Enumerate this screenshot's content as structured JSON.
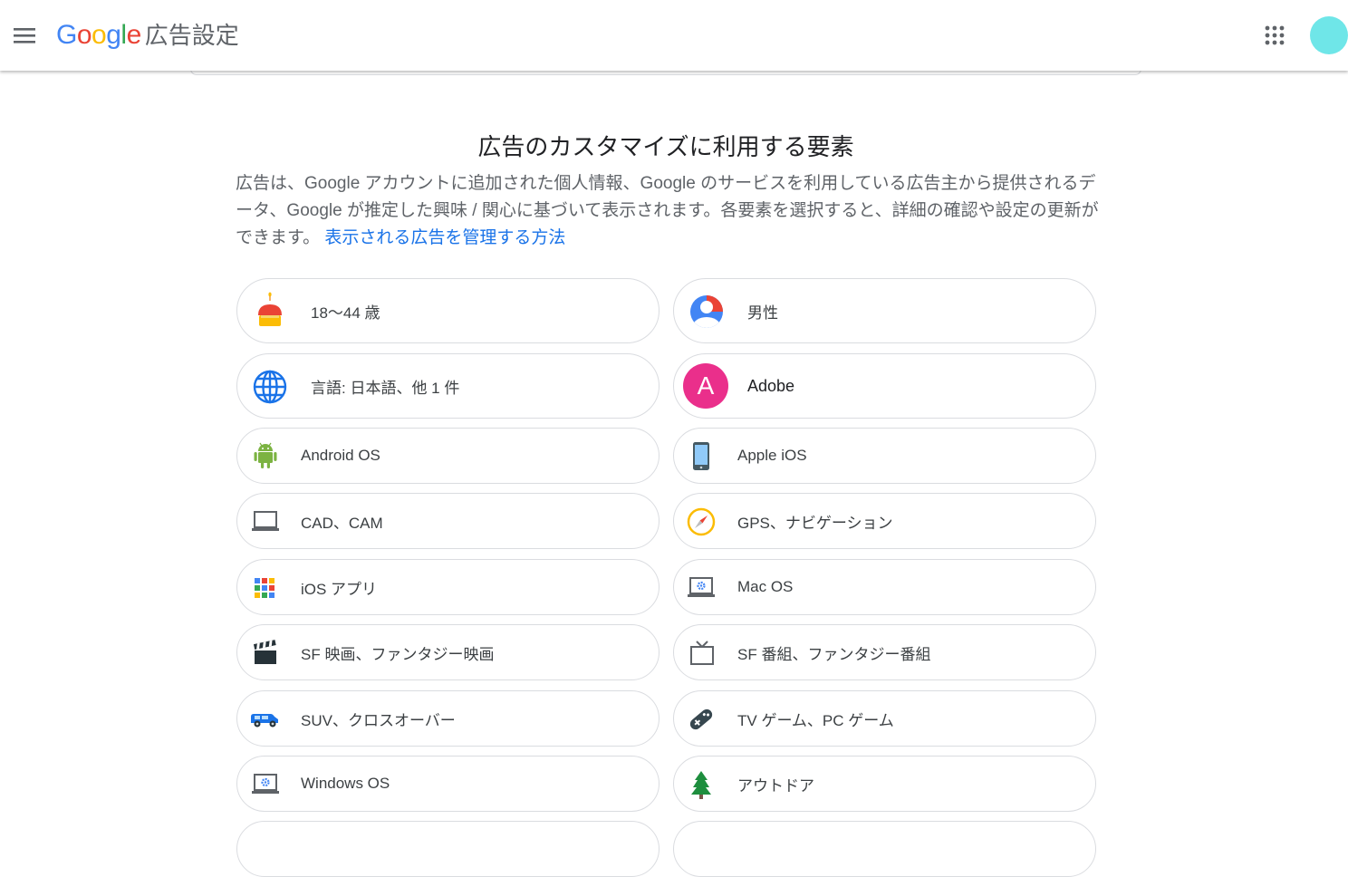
{
  "header": {
    "google_wordmark": [
      "G",
      "o",
      "o",
      "g",
      "l",
      "e"
    ],
    "product_name": "広告設定"
  },
  "colors": {
    "google_blue": "#4285F4",
    "google_red": "#EA4335",
    "google_yellow": "#FBBC05",
    "google_green": "#34A853",
    "link": "#1a73e8",
    "avatar": "#6fe6e8"
  },
  "main": {
    "title": "広告のカスタマイズに利用する要素",
    "description": "広告は、Google アカウントに追加された個人情報、Google のサービスを利用している広告主から提供されるデータ、Google が推定した興味 / 関心に基づいて表示されます。各要素を選択すると、詳細の確認や設定の更新ができます。",
    "link_text": "表示される広告を管理する方法",
    "factors": [
      {
        "label": "18〜44 歳",
        "icon": "birthday-cake-icon"
      },
      {
        "label": "男性",
        "icon": "person-icon"
      },
      {
        "label": "言語: 日本語、他 1 件",
        "icon": "globe-icon"
      },
      {
        "label": "Adobe",
        "icon": "letter-avatar-icon",
        "avatar_letter": "A"
      },
      {
        "label": "Android OS",
        "icon": "android-icon"
      },
      {
        "label": "Apple iOS",
        "icon": "phone-icon"
      },
      {
        "label": "CAD、CAM",
        "icon": "laptop-icon"
      },
      {
        "label": "GPS、ナビゲーション",
        "icon": "compass-icon"
      },
      {
        "label": "iOS アプリ",
        "icon": "app-grid-icon"
      },
      {
        "label": "Mac OS",
        "icon": "laptop-gear-icon"
      },
      {
        "label": "SF 映画、ファンタジー映画",
        "icon": "clapperboard-icon"
      },
      {
        "label": "SF 番組、ファンタジー番組",
        "icon": "tv-icon"
      },
      {
        "label": "SUV、クロスオーバー",
        "icon": "car-icon"
      },
      {
        "label": "TV ゲーム、PC ゲーム",
        "icon": "gamepad-icon"
      },
      {
        "label": "Windows OS",
        "icon": "laptop-gear-icon"
      },
      {
        "label": "アウトドア",
        "icon": "tree-icon"
      }
    ]
  }
}
